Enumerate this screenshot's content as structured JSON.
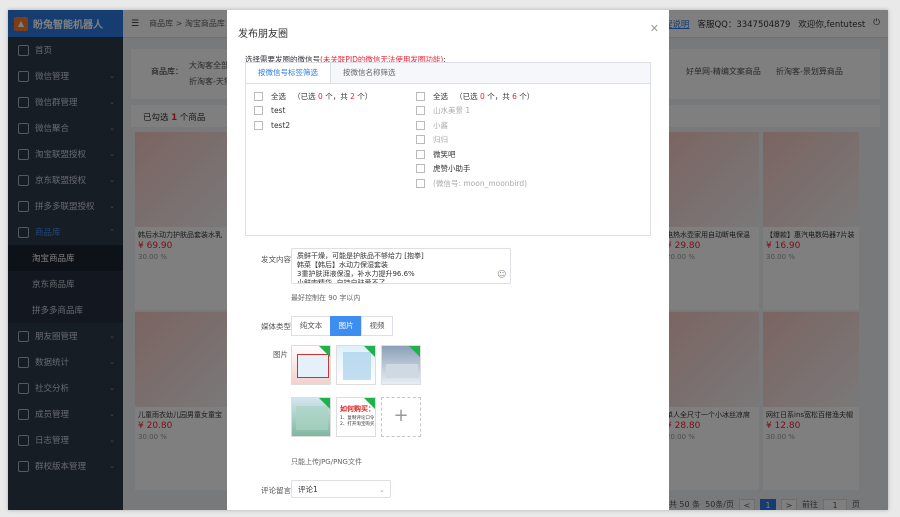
{
  "app": {
    "name": "盼兔智能机器人"
  },
  "sidebar": {
    "items": [
      {
        "label": "首页",
        "icon": "desktop-icon"
      },
      {
        "label": "微信管理",
        "icon": "wechat-icon"
      },
      {
        "label": "微信群管理",
        "icon": "group-icon"
      },
      {
        "label": "微信聚合",
        "icon": "chat-icon"
      },
      {
        "label": "淘宝联盟授权",
        "icon": "shield-icon"
      },
      {
        "label": "京东联盟授权",
        "icon": "refresh-icon"
      },
      {
        "label": "拼多多联盟授权",
        "icon": "heart-icon"
      },
      {
        "label": "商品库",
        "icon": "database-icon"
      },
      {
        "label": "朋友圈管理",
        "icon": "globe-icon"
      },
      {
        "label": "数据统计",
        "icon": "chart-icon"
      },
      {
        "label": "社交分析",
        "icon": "analytics-icon"
      },
      {
        "label": "成员管理",
        "icon": "members-icon"
      },
      {
        "label": "日志管理",
        "icon": "log-icon"
      },
      {
        "label": "群校版本管理",
        "icon": "version-icon"
      }
    ],
    "sub_items": [
      {
        "label": "淘宝商品库"
      },
      {
        "label": "京东商品库"
      },
      {
        "label": "拼多多商品库"
      }
    ]
  },
  "topbar": {
    "crumbs": "商品库 > 淘宝商品库",
    "help_link": "使用教程说明",
    "service": "客服QQ：3347504879",
    "welcome": "欢迎你,fentutest"
  },
  "background": {
    "filter_label": "商品库：",
    "filter_tags": [
      "大淘客全部",
      "折淘客-天猫",
      "好单网-精编文案商品",
      "折淘客-景划算商品"
    ],
    "summary_prefix": "已勾选",
    "summary_count": "1",
    "summary_suffix": "个商品",
    "cards": [
      {
        "title": "韩后水动力护肤品套装水乳",
        "price": "¥ 69.90",
        "rate": "30.00 %"
      },
      {
        "title": "儿童雨衣幼儿园男童女童宝",
        "price": "¥ 20.80",
        "rate": "30.00 %"
      },
      {
        "title": "电热水壶家用自动断电保温",
        "price": "¥ 29.80",
        "rate": "20.00 %"
      },
      {
        "title": "【爆款】惠汽电数码器7片装",
        "price": "¥ 16.90",
        "rate": "30.00 %"
      },
      {
        "title": "单人全尺寸一个小冰丝凉席",
        "price": "¥ 28.80",
        "rate": "20.00 %"
      },
      {
        "title": "网红日系ins宽松百搭渔夫帽",
        "price": "¥ 12.80",
        "rate": "30.00 %"
      }
    ],
    "pager": {
      "total": "共 50 条",
      "page_size": "50条/页",
      "pages": [
        "<",
        "1",
        ">"
      ],
      "goto": "前往",
      "goto_page": "1",
      "unit": "页"
    }
  },
  "modal": {
    "title": "发布朋友圈",
    "select_label": "选择需要发圈的微信号",
    "select_warning": "(未关联PID的微信无法使用发圈功能)",
    "select_colon": ":",
    "tabs": [
      "按微信号标签筛选",
      "按微信名称筛选"
    ],
    "left": {
      "select_all": "全选",
      "stat_pre": "（已选",
      "selected": "0",
      "stat_mid": "个，共",
      "total": "2",
      "stat_post": "个）",
      "items": [
        "test",
        "test2"
      ]
    },
    "right": {
      "select_all": "全选",
      "stat_pre": "（已选",
      "selected": "0",
      "stat_mid": "个，共",
      "total": "6",
      "stat_post": "个）",
      "items": [
        {
          "label": "山水美景 1",
          "disabled": true
        },
        {
          "label": "小酱",
          "disabled": true
        },
        {
          "label": "归归",
          "disabled": true
        },
        {
          "label": "微笑吧",
          "disabled": false
        },
        {
          "label": "虎赞小助手",
          "disabled": false
        },
        {
          "label": "(微信号: moon_moonbird)",
          "disabled": true
        }
      ]
    },
    "content_label": "发文内容",
    "content_lines": [
      "质鲜干燥，可能是护肤品不够给力 [抱拳]",
      "韩菜【韩后】水动力保湿套装",
      "3重护肤湃液保湿，补水力提升96.6%",
      "小鲜肉精华, 自持自驻爱不了..."
    ],
    "content_hint": "最好控制在 90 字以内",
    "media_label": "媒体类型",
    "media_options": [
      "纯文本",
      "图片",
      "视频"
    ],
    "media_selected": "图片",
    "image_label": "图片",
    "image_hint": "只能上传JPG/PNG文件",
    "image_text": {
      "t4": "如何购买：",
      "t4b": "1、复制评论口令\n2、打开淘宝购买"
    },
    "plus": "+",
    "comment_label": "评论留言",
    "comment_value": "评论1"
  }
}
